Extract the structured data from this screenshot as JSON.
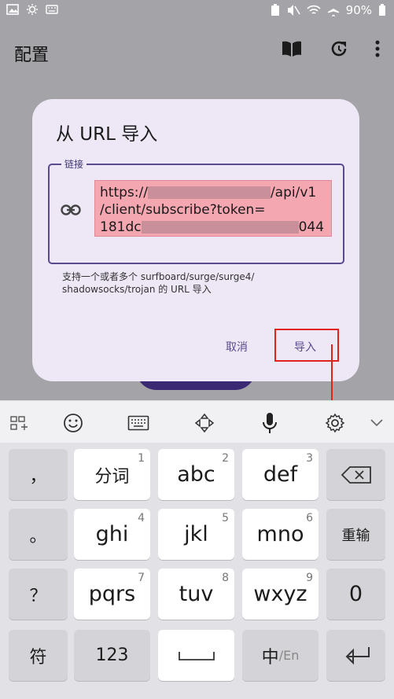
{
  "status": {
    "battery": "90%"
  },
  "appbar": {
    "title": "配置"
  },
  "dialog": {
    "title": "从 URL 导入",
    "field_label": "链接",
    "url_line1_prefix": "https://",
    "url_line1_suffix": "/api/v1",
    "url_line2": "/client/subscribe?token=",
    "url_line3_prefix": "181dc",
    "url_line3_suffix": "044",
    "helper": "支持一个或者多个 surfboard/surge/surge4/ shadowsocks/trojan 的 URL 导入",
    "cancel": "取消",
    "import": "导入"
  },
  "keyboard": {
    "rows": [
      [
        {
          "label": "，"
        },
        {
          "label": "分词",
          "hint": "1"
        },
        {
          "label": "abc",
          "hint": "2"
        },
        {
          "label": "def",
          "hint": "3"
        },
        {
          "label": "delete"
        }
      ],
      [
        {
          "label": "。"
        },
        {
          "label": "ghi",
          "hint": "4"
        },
        {
          "label": "jkl",
          "hint": "5"
        },
        {
          "label": "mno",
          "hint": "6"
        },
        {
          "label": "重输"
        }
      ],
      [
        {
          "label": "？"
        },
        {
          "label": "pqrs",
          "hint": "7"
        },
        {
          "label": "tuv",
          "hint": "8"
        },
        {
          "label": "wxyz",
          "hint": "9"
        },
        {
          "label": "0"
        }
      ],
      [
        {
          "label": "符"
        },
        {
          "label": "123"
        },
        {
          "label": "space"
        },
        {
          "label": "中",
          "sub": "/En"
        },
        {
          "label": "enter"
        }
      ]
    ]
  },
  "colors": {
    "accent": "#5a4b8f",
    "highlight": "#e1221d",
    "url_bg": "#f4a6b1"
  }
}
